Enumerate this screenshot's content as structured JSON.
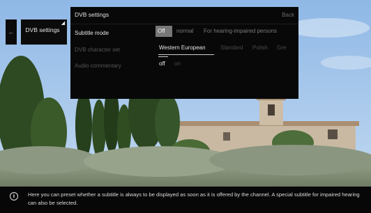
{
  "breadcrumb": {
    "back_glyph": "←",
    "label": "DVB settings",
    "corner_icon": "arrow-corner-icon"
  },
  "panel": {
    "title": "DVB settings",
    "back_label": "Back",
    "rows": [
      {
        "label": "Subtitle mode",
        "options": [
          "Off",
          "normal",
          "For hearing-impaired persons"
        ],
        "selected": "Off"
      },
      {
        "label": "DVB character set",
        "options": [
          "Western European",
          "Standard",
          "Polish",
          "Gre"
        ],
        "selected": "Western European"
      },
      {
        "label": "Audio commentary",
        "options": [
          "off",
          "on"
        ],
        "selected": "off"
      }
    ]
  },
  "info": {
    "icon": "info-icon",
    "text": "Here you can preset whether a subtitle is always to be displayed as soon as it is offered by the channel. A special subtitle for impaired hearing can also be selected."
  },
  "colors": {
    "panel_bg": "#080808",
    "selected_bg": "#777777",
    "text": "#e6e6e6",
    "dim_text": "#555555",
    "sky": "#9fc2e8"
  }
}
